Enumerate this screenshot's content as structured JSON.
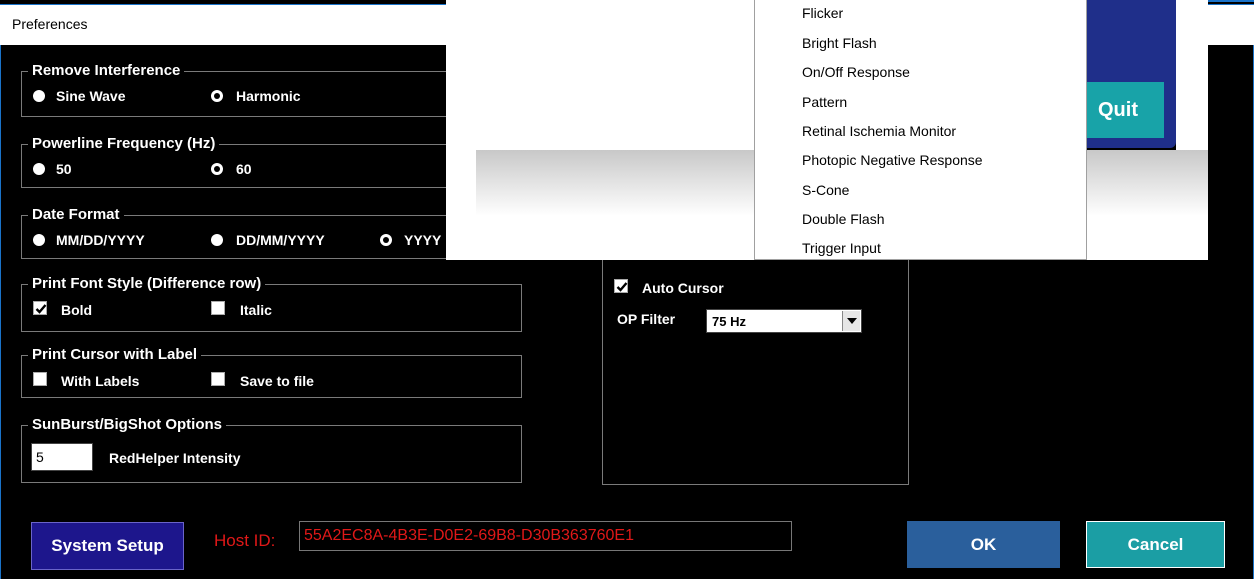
{
  "window": {
    "title": "Preferences"
  },
  "groups": {
    "remove_interference": {
      "legend": "Remove Interference",
      "options": [
        "Sine Wave",
        "Harmonic"
      ],
      "selected": "Harmonic"
    },
    "powerline": {
      "legend": "Powerline Frequency (Hz)",
      "options": [
        "50",
        "60"
      ],
      "selected": "60"
    },
    "date_format": {
      "legend": "Date Format",
      "options": [
        "MM/DD/YYYY",
        "DD/MM/YYYY",
        "YYYY"
      ],
      "selected": "YYYY"
    },
    "print_font": {
      "legend": "Print Font Style (Difference row)",
      "bold": {
        "label": "Bold",
        "checked": true
      },
      "italic": {
        "label": "Italic",
        "checked": false
      }
    },
    "print_cursor": {
      "legend": "Print Cursor with Label",
      "with_labels": {
        "label": "With Labels",
        "checked": false
      },
      "save_to_file": {
        "label": "Save to file",
        "checked": false
      }
    },
    "sunburst": {
      "legend": "SunBurst/BigShot Options",
      "intensity_value": "5",
      "intensity_label": "RedHelper Intensity"
    }
  },
  "right_panel": {
    "auto_cursor": {
      "label": "Auto Cursor",
      "checked": true
    },
    "op_filter": {
      "label": "OP Filter",
      "value": "75 Hz"
    }
  },
  "dropdown_menu": {
    "items": [
      "Flicker",
      "Bright Flash",
      "On/Off Response",
      "Pattern",
      "Retinal Ischemia Monitor",
      "Photopic Negative Response",
      "S-Cone",
      "Double Flash",
      "Trigger Input"
    ]
  },
  "background_window": {
    "quit_label": "Quit"
  },
  "footer": {
    "system_setup": "System Setup",
    "host_id_label": "Host ID:",
    "host_id_value": "55A2EC8A-4B3E-D0E2-69B8-D30B363760E1",
    "ok": "OK",
    "cancel": "Cancel"
  },
  "colors": {
    "accent_blue": "#1a73c9",
    "quit_teal": "#18a3a8",
    "ok_blue": "#2a5f9c",
    "cancel_teal": "#1b9ea4",
    "system_setup": "#1d168c",
    "host_red": "#e01818"
  }
}
